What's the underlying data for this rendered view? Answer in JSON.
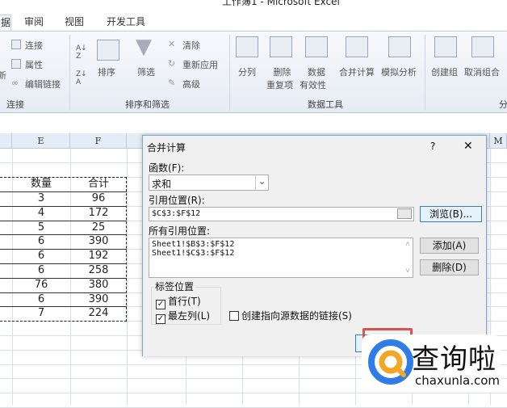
{
  "window": {
    "title": "工作簿1 - Microsoft Excel"
  },
  "tabs": [
    {
      "label": "据",
      "active": true
    },
    {
      "label": "审阅"
    },
    {
      "label": "视图"
    },
    {
      "label": "开发工具"
    }
  ],
  "ribbon": {
    "connections": {
      "partial": "新",
      "connect": "连接",
      "properties": "属性",
      "edit_links": "编辑链接",
      "group": "连接"
    },
    "sort_filter": {
      "sort": "排序",
      "filter": "筛选",
      "clear": "清除",
      "reapply": "重新应用",
      "advanced": "高级",
      "group": "排序和筛选"
    },
    "data_tools": {
      "text_to_columns": "分列",
      "remove_dup_1": "删除",
      "remove_dup_2": "重复项",
      "validation_1": "数据",
      "validation_2": "有效性",
      "consolidate": "合并计算",
      "what_if": "模拟分析",
      "group": "数据工具"
    },
    "outline": {
      "group_btn": "创建组",
      "ungroup": "取消组合",
      "group": "分"
    }
  },
  "sheet": {
    "columns": [
      "E",
      "F",
      "M"
    ],
    "headers": [
      "数量",
      "合计"
    ],
    "rows": [
      [
        "3",
        "96"
      ],
      [
        "4",
        "172"
      ],
      [
        "5",
        "25"
      ],
      [
        "6",
        "390"
      ],
      [
        "6",
        "192"
      ],
      [
        "6",
        "258"
      ],
      [
        "76",
        "380"
      ],
      [
        "6",
        "390"
      ],
      [
        "7",
        "224"
      ]
    ]
  },
  "dialog": {
    "title": "合并计算",
    "help": "?",
    "close": "✕",
    "function_label": "函数(F):",
    "function_value": "求和",
    "reference_label": "引用位置(R):",
    "reference_value": "$C$3:$F$12",
    "browse": "浏览(B)...",
    "all_refs_label": "所有引用位置:",
    "all_refs": [
      "Sheet1!$B$3:$F$12",
      "Sheet1!$C$3:$F$12"
    ],
    "add": "添加(A)",
    "delete": "删除(D)",
    "labels_group": "标签位置",
    "top_row": "首行(T)",
    "left_col": "最左列(L)",
    "link": "创建指向源数据的链接(S)",
    "top_row_checked": true,
    "left_col_checked": true,
    "link_checked": false
  },
  "watermark": {
    "name": "查询啦",
    "url": "chaxunla.com"
  }
}
